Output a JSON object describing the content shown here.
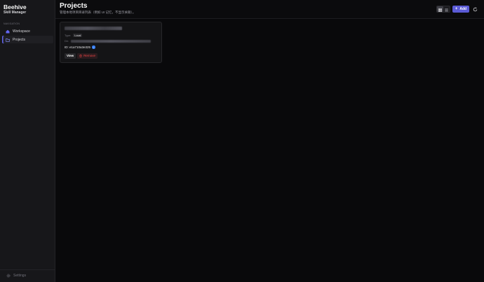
{
  "app": {
    "title": "Beehive",
    "subtitle": "Skill Manager"
  },
  "nav": {
    "section_label": "NAVIGATION",
    "items": [
      {
        "label": "Workspace",
        "icon": "home-icon",
        "active": false
      },
      {
        "label": "Projects",
        "icon": "folder-icon",
        "active": true
      }
    ],
    "settings_label": "Settings"
  },
  "header": {
    "title": "Projects",
    "description": "管理本地项目目录列表（例如 UI 记忆，不显示关联）。",
    "add_label": "Add"
  },
  "projects": [
    {
      "type_label": "Type:",
      "type_value": "Local",
      "dir_label": "Dir:",
      "id_text": "ID: e1a710a3e325",
      "view_label": "View",
      "remove_label": "Remove"
    }
  ],
  "colors": {
    "accent": "#5b5bd6",
    "danger": "#ef4444",
    "background": "#09090b"
  }
}
